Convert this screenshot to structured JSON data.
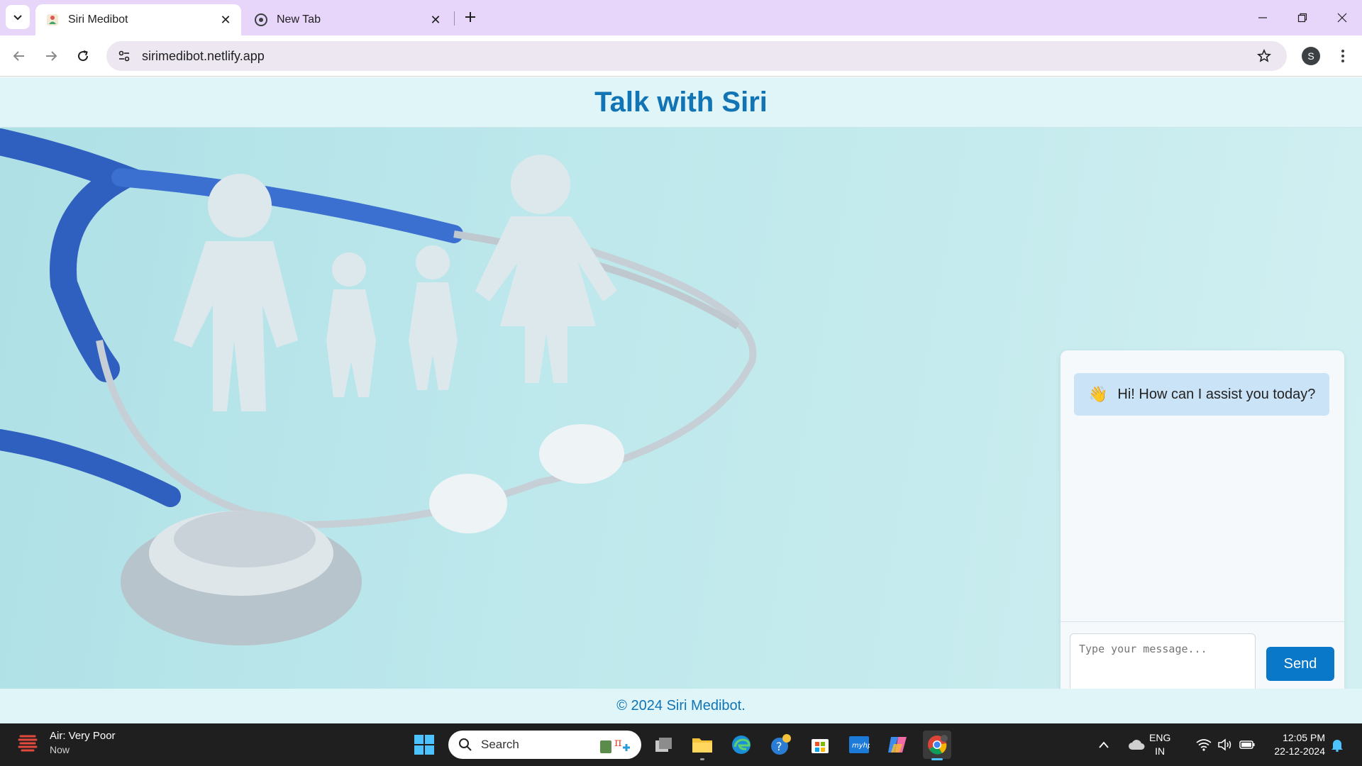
{
  "browser": {
    "tabs": [
      {
        "title": "Siri Medibot",
        "active": true
      },
      {
        "title": "New Tab",
        "active": false
      }
    ],
    "url": "sirimedibot.netlify.app",
    "profile_initial": "S"
  },
  "page": {
    "title": "Talk with Siri",
    "chat": {
      "messages": [
        {
          "sender": "bot",
          "emoji": "👋",
          "text": "Hi! How can I assist you today?"
        }
      ],
      "input_placeholder": "Type your message...",
      "send_label": "Send"
    },
    "footer": "© 2024 Siri Medibot."
  },
  "taskbar": {
    "weather": {
      "line1": "Air: Very Poor",
      "line2": "Now"
    },
    "search_placeholder": "Search",
    "language": {
      "line1": "ENG",
      "line2": "IN"
    },
    "clock": {
      "time": "12:05 PM",
      "date": "22-12-2024"
    },
    "pinned_apps": [
      "task-view-icon",
      "file-explorer-icon",
      "edge-icon",
      "get-help-icon",
      "microsoft-store-icon",
      "myhp-icon",
      "copilot-icon",
      "chrome-icon"
    ]
  },
  "colors": {
    "accent": "#1174b5",
    "send_button": "#0a78c8",
    "tabstrip": "#e8d5fa",
    "hero_bg": "#bfe6ea"
  }
}
